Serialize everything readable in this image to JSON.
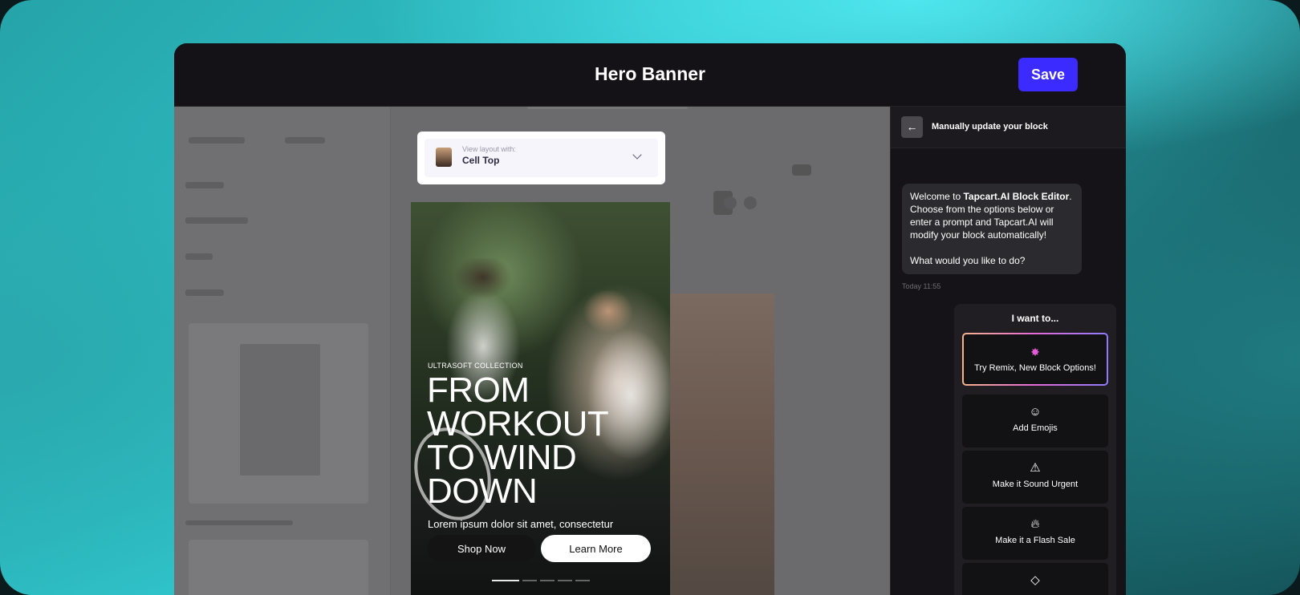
{
  "header": {
    "title": "Hero Banner",
    "save_label": "Save"
  },
  "layout_select": {
    "caption": "View layout with:",
    "value": "Cell Top"
  },
  "hero": {
    "eyebrow": "ULTRASOFT COLLECTION",
    "title_lines": [
      "FROM",
      "WORKOUT",
      "TO WIND",
      "DOWN"
    ],
    "subtitle": "Lorem ipsum dolor sit amet, consectetur",
    "primary_button": "Shop Now",
    "secondary_button": "Learn More",
    "slide_count": 5,
    "active_slide": 1
  },
  "chat": {
    "header_label": "Manually update your block",
    "message": {
      "prefix": "Welcome to ",
      "brand": "Tapcart.AI Block Editor",
      "body": ". Choose from the options below or enter a prompt and Tapcart.AI will modify your block automatically!",
      "question": "What would you like to do?"
    },
    "timestamp": "Today 11:55",
    "options_heading": "I want to...",
    "options": [
      {
        "label": "Try Remix, New Block Options!",
        "icon": "sparkle-icon"
      },
      {
        "label": "Add Emojis",
        "icon": "smiley-icon"
      },
      {
        "label": "Make it Sound Urgent",
        "icon": "warning-icon"
      },
      {
        "label": "Make it a Flash Sale",
        "icon": "flame-icon"
      }
    ]
  },
  "colors": {
    "accent": "#3b2bff",
    "panel": "#151317",
    "remix_gradient": [
      "#f6b38a",
      "#e46ad6",
      "#8f7bff"
    ]
  }
}
